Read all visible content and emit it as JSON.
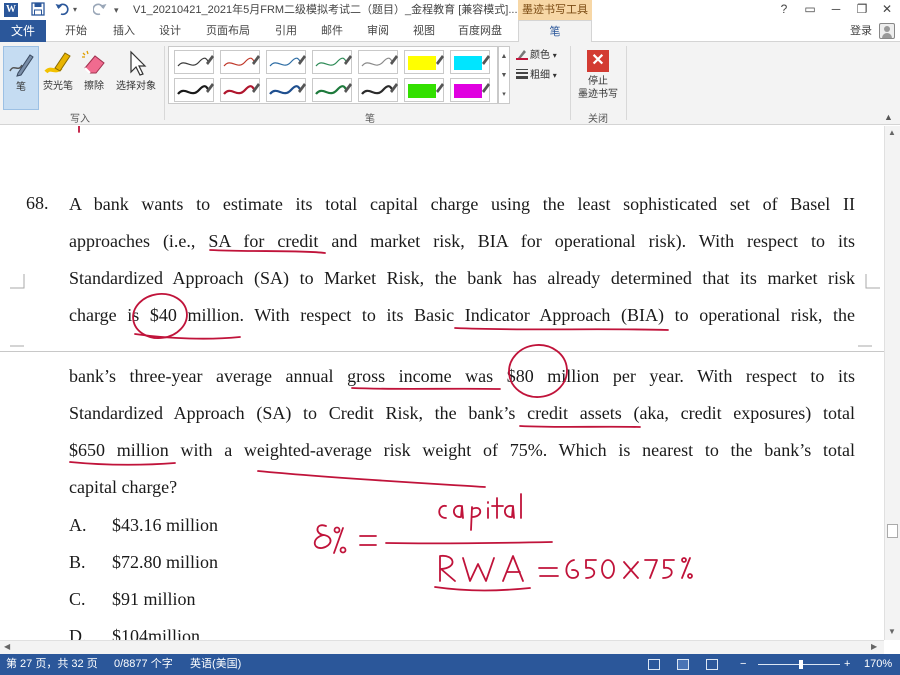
{
  "titlebar": {
    "app_icon": "word-icon",
    "save_icon": "save-icon",
    "undo_icon": "undo-icon",
    "redo_icon": "redo-icon",
    "customize_icon": "chevron-down-icon",
    "doc_title": "V1_20210421_2021年5月FRM二级模拟考试二（题目）_金程教育 [兼容模式]...",
    "context_tool_group": "墨迹书写工具",
    "window_buttons": [
      "?",
      "▭",
      "─",
      "❐",
      "✕"
    ]
  },
  "tabs": {
    "file": "文件",
    "items": [
      "开始",
      "插入",
      "设计",
      "页面布局",
      "引用",
      "邮件",
      "审阅",
      "视图",
      "百度网盘"
    ],
    "active": "笔",
    "login": "登录"
  },
  "ribbon": {
    "write_group": {
      "label": "写入",
      "pen": "笔",
      "highlighter": "荧光笔",
      "eraser": "擦除",
      "select_objects": "选择对象"
    },
    "pens_group": {
      "label": "笔",
      "row1_colors": [
        "#3a3a3a",
        "#c0392b",
        "#2e6da4",
        "#2e8b57",
        "#8a8a8a",
        "#ffff00",
        "#00e5ff"
      ],
      "row2_colors": [
        "#1a1a1a",
        "#b0162e",
        "#1f4f8f",
        "#1e7a3c",
        "#2b2b2b",
        "#33e000",
        "#e000e0"
      ],
      "color_label": "颜色",
      "thickness_label": "粗细"
    },
    "close_group": {
      "label": "关闭",
      "stop_inking_line1": "停止",
      "stop_inking_line2": "墨迹书写"
    }
  },
  "document": {
    "question_number": "68.",
    "lines_page1": [
      "A bank wants to estimate its total capital charge using the least sophisticated set of Basel II",
      "approaches (i.e., SA for credit and market risk, BIA for operational risk). With respect to its",
      "Standardized Approach (SA) to Market Risk, the bank has already determined that its market risk",
      "charge is $40 million. With respect to its Basic Indicator Approach (BIA) to operational risk, the"
    ],
    "lines_page2": [
      "bank’s three-year average annual gross income was $80 million per year. With respect to its",
      "Standardized Approach (SA) to Credit Risk, the bank’s credit assets (aka, credit exposures) total",
      "$650 million with a weighted-average risk weight of 75%. Which is nearest to the bank’s total"
    ],
    "last_line": "capital charge?",
    "options": [
      {
        "letter": "A.",
        "text": "$43.16 million"
      },
      {
        "letter": "B.",
        "text": "$72.80 million"
      },
      {
        "letter": "C.",
        "text": "$91 million"
      },
      {
        "letter": "D.",
        "text": "$104million"
      }
    ],
    "ink_annotation": {
      "color": "#c0133a",
      "text": [
        "8%",
        "capital",
        "RWA",
        "650 × 75%"
      ]
    }
  },
  "statusbar": {
    "page": "第 27 页，共 32 页",
    "words": "0/8877 个字",
    "language": "英语(美国)",
    "zoom": "170%",
    "zoom_fraction": 0.52
  }
}
